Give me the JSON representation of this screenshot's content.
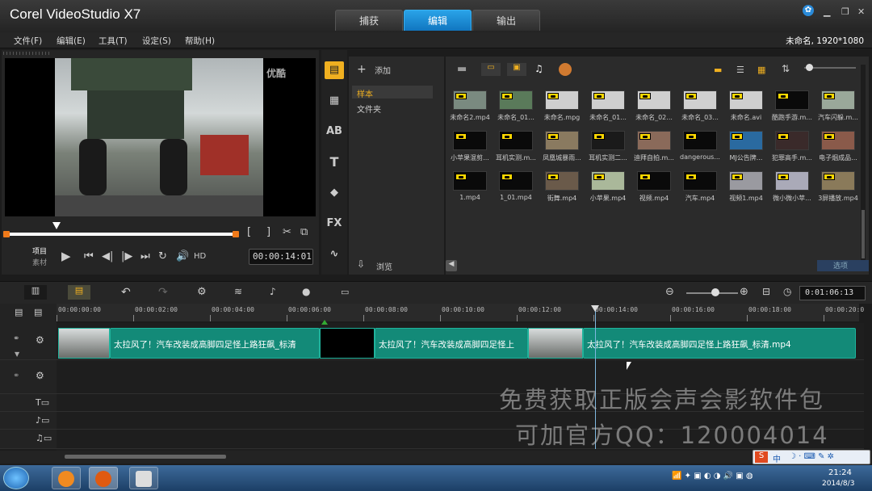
{
  "app": {
    "title": "Corel VideoStudio X7"
  },
  "tabs": [
    {
      "label": "捕获"
    },
    {
      "label": "编辑"
    },
    {
      "label": "输出"
    }
  ],
  "menu": [
    {
      "label": "文件(F)"
    },
    {
      "label": "编辑(E)"
    },
    {
      "label": "工具(T)"
    },
    {
      "label": "设定(S)"
    },
    {
      "label": "帮助(H)"
    }
  ],
  "project_info": "未命名, 1920*1080",
  "player": {
    "overlay_logo": "优酷",
    "mode_project": "项目",
    "mode_clip": "素材",
    "hd_label": "HD",
    "timecode": "00:00:14:01"
  },
  "library": {
    "add_label": "添加",
    "nav": [
      {
        "label": "样本"
      },
      {
        "label": "文件夹"
      }
    ],
    "browse_label": "浏览",
    "options_label": "选项",
    "items": [
      {
        "name": "未命名2.mp4",
        "color": "#7a8a80"
      },
      {
        "name": "未命名_01...",
        "color": "#5a7a5a"
      },
      {
        "name": "未命名.mpg",
        "color": "#cfcfcf"
      },
      {
        "name": "未命名_01...",
        "color": "#cfcfcf"
      },
      {
        "name": "未命名_02...",
        "color": "#cfcfcf"
      },
      {
        "name": "未命名_03...",
        "color": "#d0d0d0"
      },
      {
        "name": "未命名.avi",
        "color": "#cfcfcf"
      },
      {
        "name": "酷跑手游.m...",
        "color": "#0a0a0a"
      },
      {
        "name": "汽车闪躲.m...",
        "color": "#9aa89a"
      },
      {
        "name": "小苹果混剪...",
        "color": "#0a0a0a"
      },
      {
        "name": "耳机实测.m...",
        "color": "#0a0a0a"
      },
      {
        "name": "凤凰城暴雨...",
        "color": "#8a7a60"
      },
      {
        "name": "耳机实测二...",
        "color": "#1a1a1a"
      },
      {
        "name": "迪拜自拍.m...",
        "color": "#8a6a5a"
      },
      {
        "name": "dangerous...",
        "color": "#0a0a0a"
      },
      {
        "name": "MJ公告牌...",
        "color": "#2a6aa0"
      },
      {
        "name": "犯罪高手.m...",
        "color": "#3a2a2a"
      },
      {
        "name": "电子烟成品...",
        "color": "#8a5a4a"
      },
      {
        "name": "1.mp4",
        "color": "#0a0a0a"
      },
      {
        "name": "1_01.mp4",
        "color": "#0a0a0a"
      },
      {
        "name": "街舞.mp4",
        "color": "#6a5a4a"
      },
      {
        "name": "小苹果.mp4",
        "color": "#aab89a"
      },
      {
        "name": "视频.mp4",
        "color": "#0a0a0a"
      },
      {
        "name": "汽车.mp4",
        "color": "#0a0a0a"
      },
      {
        "name": "视频1.mp4",
        "color": "#9a9aa0"
      },
      {
        "name": "微小微小苹...",
        "color": "#aaaab8"
      },
      {
        "name": "3屏播放.mp4",
        "color": "#8a7a5a"
      }
    ]
  },
  "timeline": {
    "timecode": "0:01:06:13",
    "ruler": [
      "00:00:00:00",
      "00:00:02:00",
      "00:00:04:00",
      "00:00:06:00",
      "00:00:08:00",
      "00:00:10:00",
      "00:00:12:00",
      "00:00:14:00",
      "00:00:16:00",
      "00:00:18:00",
      "00:00:20:0"
    ],
    "clips": [
      {
        "label": "太拉风了！汽车改装成高脚四足怪上路狂飙_标清"
      },
      {
        "label": "太拉风了！汽车改装成高脚四足怪上"
      },
      {
        "label": "太拉风了！汽车改装成高脚四足怪上路狂飙_标清.mp4"
      }
    ]
  },
  "watermark": {
    "line1": "免费获取正版会声会影软件包",
    "line2": "可加官方QQ：120004014"
  },
  "taskbar": {
    "time": "21:24",
    "date": "2014/8/3"
  },
  "ime": {
    "label": "中"
  }
}
